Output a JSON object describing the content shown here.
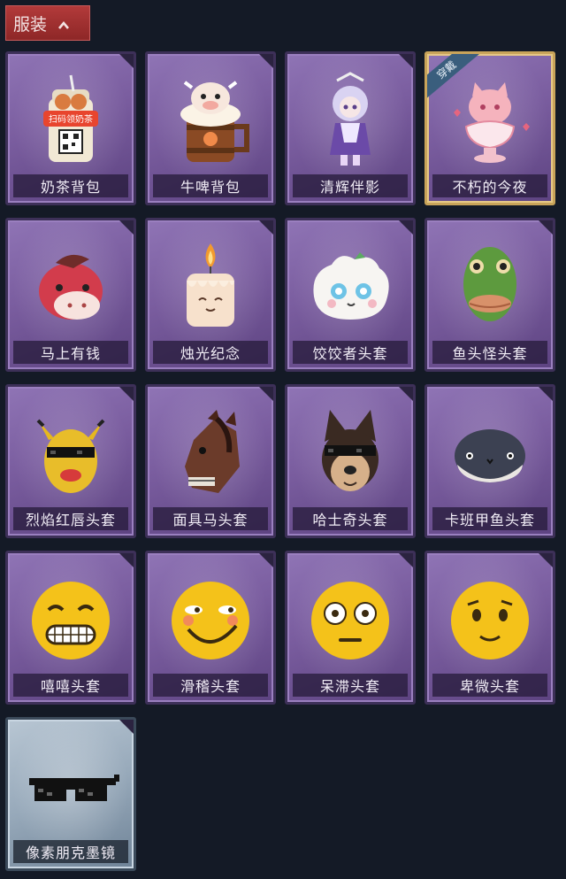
{
  "header": {
    "title": "服装",
    "toggle_icon": "chevron-up-icon"
  },
  "items": [
    {
      "label": "奶茶背包",
      "rarity": "purple",
      "icon": "milk-tea-backpack"
    },
    {
      "label": "牛啤背包",
      "rarity": "purple",
      "icon": "cow-beer-backpack"
    },
    {
      "label": "清辉伴影",
      "rarity": "purple",
      "icon": "companion-figure"
    },
    {
      "label": "不朽的今夜",
      "rarity": "purple",
      "icon": "pink-cat-bowl",
      "equipped_badge": "穿戴"
    },
    {
      "label": "马上有钱",
      "rarity": "purple",
      "icon": "red-horse-head"
    },
    {
      "label": "烛光纪念",
      "rarity": "purple",
      "icon": "candle"
    },
    {
      "label": "饺饺者头套",
      "rarity": "purple",
      "icon": "dumpling-head"
    },
    {
      "label": "鱼头怪头套",
      "rarity": "purple",
      "icon": "fish-head"
    },
    {
      "label": "烈焰红唇头套",
      "rarity": "purple",
      "icon": "yellow-mask-sunglasses"
    },
    {
      "label": "面具马头套",
      "rarity": "purple",
      "icon": "horse-mask"
    },
    {
      "label": "哈士奇头套",
      "rarity": "purple",
      "icon": "husky-head"
    },
    {
      "label": "卡班甲鱼头套",
      "rarity": "purple",
      "icon": "fish-ball-head"
    },
    {
      "label": "嘻嘻头套",
      "rarity": "purple",
      "icon": "grin-emoji"
    },
    {
      "label": "滑稽头套",
      "rarity": "purple",
      "icon": "funny-emoji"
    },
    {
      "label": "呆滞头套",
      "rarity": "purple",
      "icon": "dazed-emoji"
    },
    {
      "label": "卑微头套",
      "rarity": "purple",
      "icon": "humble-emoji"
    },
    {
      "label": "像素朋克墨镜",
      "rarity": "blue",
      "icon": "pixel-sunglasses"
    }
  ],
  "milk_tea_sign": "扫码领奶茶",
  "colors": {
    "purple_card": "#7a5d9f",
    "blue_card": "#97a9ba",
    "header": "#a53232",
    "background": "#141a26",
    "equipped_border": "#c9a45a"
  }
}
